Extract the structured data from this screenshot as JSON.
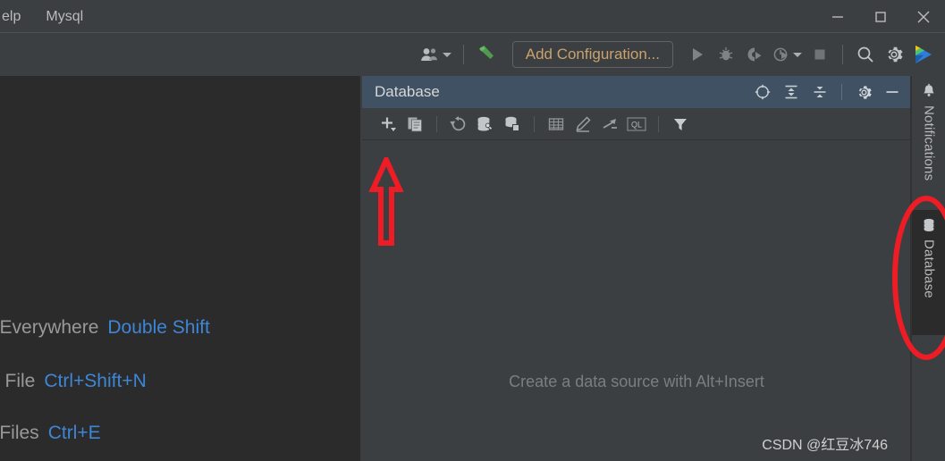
{
  "window": {
    "menu_items": [
      "elp",
      "Mysql"
    ],
    "controls": {
      "minimize": "minimize-icon",
      "maximize": "maximize-icon",
      "close": "close-icon"
    }
  },
  "toolbar": {
    "user_icon": "user-icon",
    "user_dropdown": "chevron-down-icon",
    "build_icon": "hammer-build-icon",
    "add_configuration_label": "Add Configuration...",
    "run_icon": "run-icon",
    "debug_icon": "debug-bug-icon",
    "coverage_icon": "run-with-coverage-icon",
    "profile_icon": "profile-icon",
    "profile_dropdown": "chevron-down-icon",
    "stop_icon": "stop-icon",
    "search_icon": "search-icon",
    "settings_icon": "gear-icon",
    "ide_icon": "ide-logo-icon"
  },
  "editor": {
    "shortcuts": [
      {
        "label": "h Everywhere",
        "key": "Double Shift"
      },
      {
        "label": " File",
        "key": "Ctrl+Shift+N"
      },
      {
        "label": "nt Files",
        "key": "Ctrl+E"
      }
    ]
  },
  "database_tool_window": {
    "title": "Database",
    "header_actions": [
      {
        "name": "scroll-from-source-icon",
        "label": "Scroll from Source"
      },
      {
        "name": "expand-all-icon",
        "label": "Expand All"
      },
      {
        "name": "collapse-all-icon",
        "label": "Collapse All"
      },
      {
        "name": "gear-icon",
        "label": "Options"
      },
      {
        "name": "hide-icon",
        "label": "Hide"
      }
    ],
    "toolbar_actions": [
      {
        "name": "add-plus-icon",
        "label": "New"
      },
      {
        "name": "duplicate-icon",
        "label": "Duplicate"
      },
      {
        "name": "refresh-icon",
        "label": "Refresh"
      },
      {
        "name": "data-source-properties-icon",
        "label": "Data Source Properties"
      },
      {
        "name": "database-object-icon",
        "label": "Database Object"
      },
      {
        "name": "table-grid-icon",
        "label": "Open Table Editor"
      },
      {
        "name": "edit-pencil-icon",
        "label": "Modify Object"
      },
      {
        "name": "jump-to-editor-icon",
        "label": "Jump to Console"
      },
      {
        "name": "query-console-icon",
        "label": "QL"
      },
      {
        "name": "filter-icon",
        "label": "Filter"
      }
    ],
    "empty_state_text": "Create a data source with Alt+Insert"
  },
  "tool_stripe": {
    "items": [
      {
        "icon": "bell-notifications-icon",
        "label": "Notifications",
        "active": false
      },
      {
        "icon": "database-icon",
        "label": "Database",
        "active": true
      }
    ]
  },
  "annotations": {
    "arrow": {
      "name": "red-arrow-annotation",
      "color": "#ee1c24"
    },
    "ellipse": {
      "name": "red-ellipse-annotation",
      "color": "#ee1c24"
    }
  },
  "watermark": {
    "text": "CSDN @红豆冰746"
  },
  "colors": {
    "editor_bg": "#2b2b2b",
    "panel_bg": "#3c3f41",
    "header_active_bg": "#3f5163",
    "accent_orange": "#c9a26d",
    "link_blue": "#3e86d6",
    "annotation_red": "#ee1c24"
  }
}
